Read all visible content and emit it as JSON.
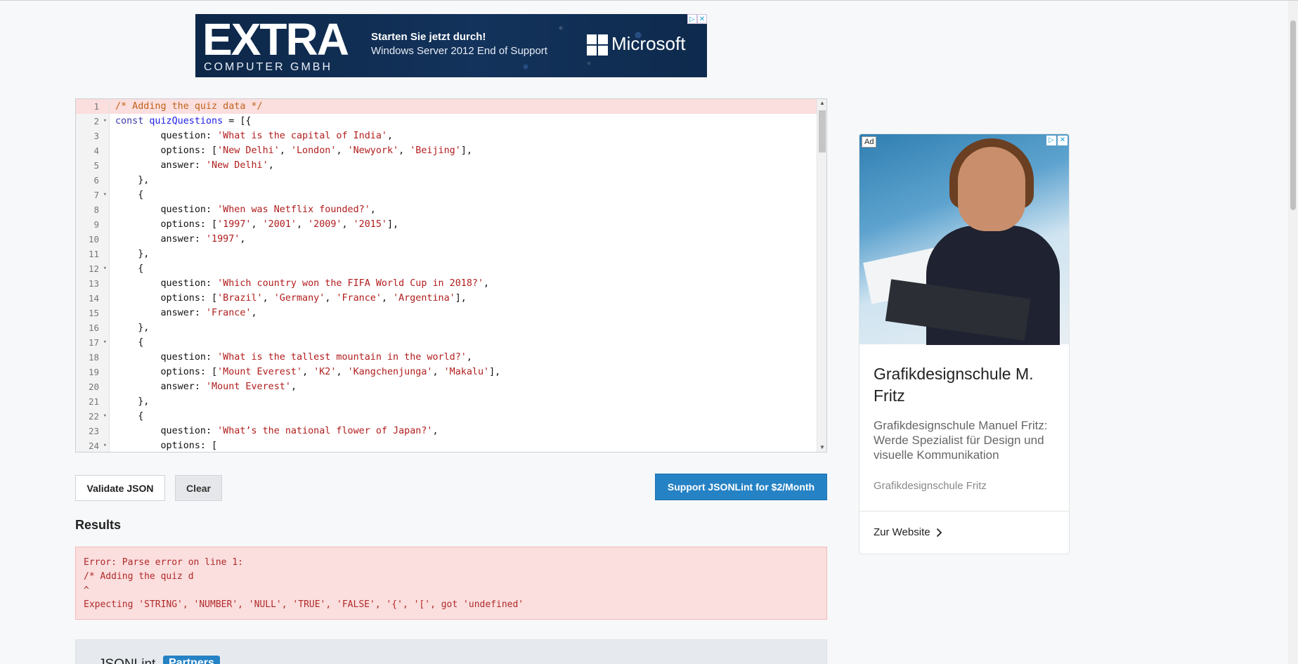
{
  "banner_ad": {
    "logo": "EXTRA",
    "logo_sub": "COMPUTER GMBH",
    "headline": "Starten Sie jetzt durch!",
    "subline": "Windows Server 2012 End of Support",
    "brand": "Microsoft"
  },
  "editor": {
    "lines": [
      {
        "n": "1",
        "fold": false,
        "err": true,
        "tokens": [
          [
            "comment",
            "/* Adding the quiz data */"
          ]
        ]
      },
      {
        "n": "2",
        "fold": true,
        "err": false,
        "tokens": [
          [
            "kw",
            "const "
          ],
          [
            "var",
            "quizQuestions"
          ],
          [
            "plain",
            " = [{"
          ]
        ]
      },
      {
        "n": "3",
        "fold": false,
        "err": false,
        "tokens": [
          [
            "plain",
            "        question: "
          ],
          [
            "str",
            "'What is the capital of India'"
          ],
          [
            "plain",
            ","
          ]
        ]
      },
      {
        "n": "4",
        "fold": false,
        "err": false,
        "tokens": [
          [
            "plain",
            "        options: ["
          ],
          [
            "str",
            "'New Delhi'"
          ],
          [
            "plain",
            ", "
          ],
          [
            "str",
            "'London'"
          ],
          [
            "plain",
            ", "
          ],
          [
            "str",
            "'Newyork'"
          ],
          [
            "plain",
            ", "
          ],
          [
            "str",
            "'Beijing'"
          ],
          [
            "plain",
            "],"
          ]
        ]
      },
      {
        "n": "5",
        "fold": false,
        "err": false,
        "tokens": [
          [
            "plain",
            "        answer: "
          ],
          [
            "str",
            "'New Delhi'"
          ],
          [
            "plain",
            ","
          ]
        ]
      },
      {
        "n": "6",
        "fold": false,
        "err": false,
        "tokens": [
          [
            "plain",
            "    },"
          ]
        ]
      },
      {
        "n": "7",
        "fold": true,
        "err": false,
        "tokens": [
          [
            "plain",
            "    {"
          ]
        ]
      },
      {
        "n": "8",
        "fold": false,
        "err": false,
        "tokens": [
          [
            "plain",
            "        question: "
          ],
          [
            "str",
            "'When was Netflix founded?'"
          ],
          [
            "plain",
            ","
          ]
        ]
      },
      {
        "n": "9",
        "fold": false,
        "err": false,
        "tokens": [
          [
            "plain",
            "        options: ["
          ],
          [
            "str",
            "'1997'"
          ],
          [
            "plain",
            ", "
          ],
          [
            "str",
            "'2001'"
          ],
          [
            "plain",
            ", "
          ],
          [
            "str",
            "'2009'"
          ],
          [
            "plain",
            ", "
          ],
          [
            "str",
            "'2015'"
          ],
          [
            "plain",
            "],"
          ]
        ]
      },
      {
        "n": "10",
        "fold": false,
        "err": false,
        "tokens": [
          [
            "plain",
            "        answer: "
          ],
          [
            "str",
            "'1997'"
          ],
          [
            "plain",
            ","
          ]
        ]
      },
      {
        "n": "11",
        "fold": false,
        "err": false,
        "tokens": [
          [
            "plain",
            "    },"
          ]
        ]
      },
      {
        "n": "12",
        "fold": true,
        "err": false,
        "tokens": [
          [
            "plain",
            "    {"
          ]
        ]
      },
      {
        "n": "13",
        "fold": false,
        "err": false,
        "tokens": [
          [
            "plain",
            "        question: "
          ],
          [
            "str",
            "'Which country won the FIFA World Cup in 2018?'"
          ],
          [
            "plain",
            ","
          ]
        ]
      },
      {
        "n": "14",
        "fold": false,
        "err": false,
        "tokens": [
          [
            "plain",
            "        options: ["
          ],
          [
            "str",
            "'Brazil'"
          ],
          [
            "plain",
            ", "
          ],
          [
            "str",
            "'Germany'"
          ],
          [
            "plain",
            ", "
          ],
          [
            "str",
            "'France'"
          ],
          [
            "plain",
            ", "
          ],
          [
            "str",
            "'Argentina'"
          ],
          [
            "plain",
            "],"
          ]
        ]
      },
      {
        "n": "15",
        "fold": false,
        "err": false,
        "tokens": [
          [
            "plain",
            "        answer: "
          ],
          [
            "str",
            "'France'"
          ],
          [
            "plain",
            ","
          ]
        ]
      },
      {
        "n": "16",
        "fold": false,
        "err": false,
        "tokens": [
          [
            "plain",
            "    },"
          ]
        ]
      },
      {
        "n": "17",
        "fold": true,
        "err": false,
        "tokens": [
          [
            "plain",
            "    {"
          ]
        ]
      },
      {
        "n": "18",
        "fold": false,
        "err": false,
        "tokens": [
          [
            "plain",
            "        question: "
          ],
          [
            "str",
            "'What is the tallest mountain in the world?'"
          ],
          [
            "plain",
            ","
          ]
        ]
      },
      {
        "n": "19",
        "fold": false,
        "err": false,
        "tokens": [
          [
            "plain",
            "        options: ["
          ],
          [
            "str",
            "'Mount Everest'"
          ],
          [
            "plain",
            ", "
          ],
          [
            "str",
            "'K2'"
          ],
          [
            "plain",
            ", "
          ],
          [
            "str",
            "'Kangchenjunga'"
          ],
          [
            "plain",
            ", "
          ],
          [
            "str",
            "'Makalu'"
          ],
          [
            "plain",
            "],"
          ]
        ]
      },
      {
        "n": "20",
        "fold": false,
        "err": false,
        "tokens": [
          [
            "plain",
            "        answer: "
          ],
          [
            "str",
            "'Mount Everest'"
          ],
          [
            "plain",
            ","
          ]
        ]
      },
      {
        "n": "21",
        "fold": false,
        "err": false,
        "tokens": [
          [
            "plain",
            "    },"
          ]
        ]
      },
      {
        "n": "22",
        "fold": true,
        "err": false,
        "tokens": [
          [
            "plain",
            "    {"
          ]
        ]
      },
      {
        "n": "23",
        "fold": false,
        "err": false,
        "tokens": [
          [
            "plain",
            "        question: "
          ],
          [
            "str",
            "'What’s the national flower of Japan?'"
          ],
          [
            "plain",
            ","
          ]
        ]
      },
      {
        "n": "24",
        "fold": true,
        "err": false,
        "tokens": [
          [
            "plain",
            "        options: ["
          ]
        ]
      }
    ]
  },
  "buttons": {
    "validate": "Validate JSON",
    "clear": "Clear",
    "support": "Support JSONLint for $2/Month"
  },
  "results": {
    "title": "Results",
    "message": "Error: Parse error on line 1:\n/* Adding the quiz d\n^\nExpecting 'STRING', 'NUMBER', 'NULL', 'TRUE', 'FALSE', '{', '[', got 'undefined'"
  },
  "partners": {
    "label": "JSONLint",
    "badge": "Partners"
  },
  "side_ad": {
    "tag": "Ad",
    "title": "Grafikdesignschule M. Fritz",
    "description": "Grafikdesignschule Manuel Fritz: Werde Spezialist für Design und visuelle Kommunikation",
    "brand": "Grafikdesignschule Fritz",
    "cta": "Zur Website"
  },
  "colors": {
    "accent": "#2582c5",
    "error_bg": "#fbdede",
    "error_text": "#b02a2a"
  }
}
